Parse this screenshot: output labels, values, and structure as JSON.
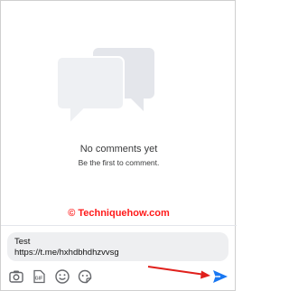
{
  "empty_state": {
    "title": "No comments yet",
    "subtitle": "Be the first to comment."
  },
  "watermark": {
    "text": "© Techniquehow.com",
    "color": "#ff1a1a"
  },
  "comment_input": {
    "lines": [
      "Test",
      "https://t.me/hxhdbhdhzvvsg"
    ]
  },
  "toolbar": {
    "icons": [
      "camera-icon",
      "gif-icon",
      "emoji-icon",
      "sticker-icon"
    ],
    "send_icon": "send-icon"
  },
  "colors": {
    "accent": "#1877f2",
    "annotation_arrow": "#e0201c",
    "illustration": "#e4e6eb",
    "input_bg": "#eeeff1"
  }
}
